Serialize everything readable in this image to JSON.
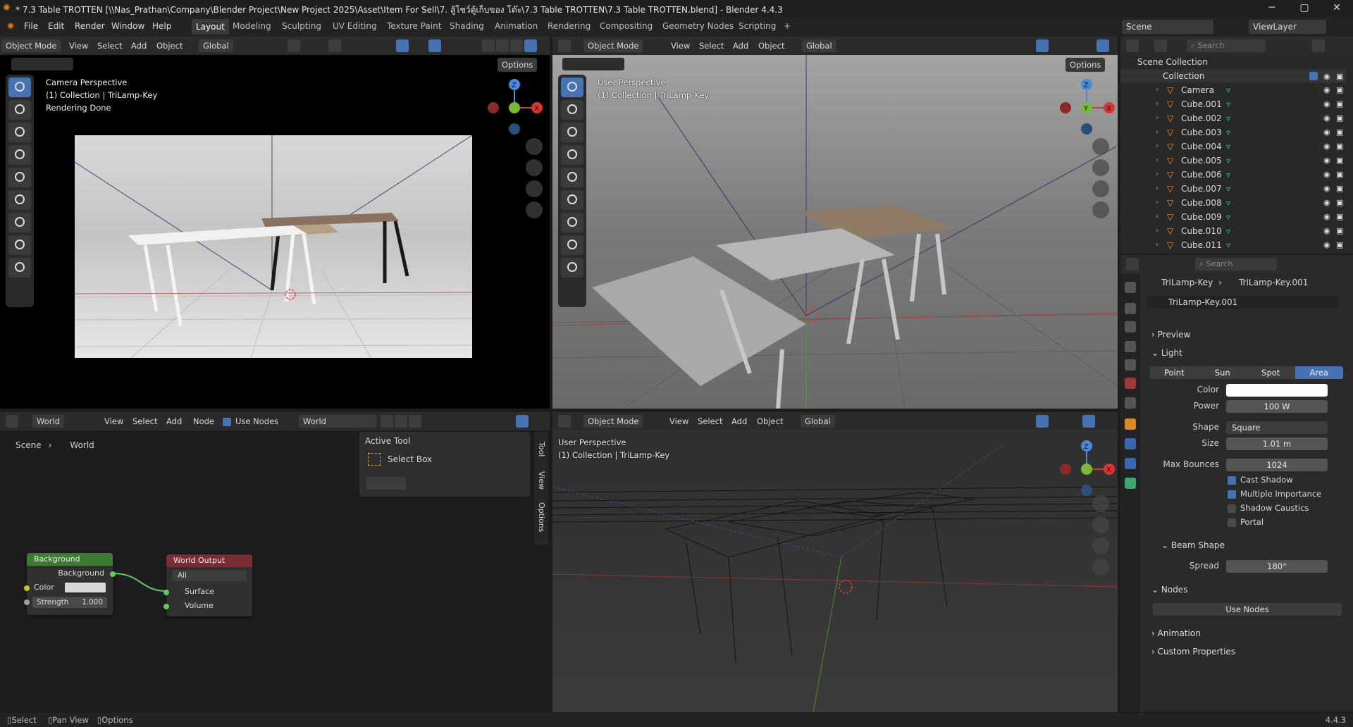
{
  "window": {
    "title": "* 7.3 Table TROTTEN [\\\\Nas_Prathan\\Company\\Blender Project\\New Project 2025\\Asset\\Item For Sell\\7. สู้โซว์ตู้เก็บของ โต๊ะ\\7.3 Table TROTTEN\\7.3 Table TROTTEN.blend] - Blender 4.4.3",
    "minimize": "─",
    "maximize": "▢",
    "close": "✕"
  },
  "menu": [
    "File",
    "Edit",
    "Render",
    "Window",
    "Help"
  ],
  "workspaces": [
    "Layout",
    "Modeling",
    "Sculpting",
    "UV Editing",
    "Texture Paint",
    "Shading",
    "Animation",
    "Rendering",
    "Compositing",
    "Geometry Nodes",
    "Scripting",
    "+"
  ],
  "scene": {
    "label": "Scene",
    "viewlayer": "ViewLayer"
  },
  "viewport_header": {
    "mode": "Object Mode",
    "items": [
      "View",
      "Select",
      "Add",
      "Object"
    ],
    "orientation": "Global",
    "options": "Options"
  },
  "camera_view": {
    "line1": "Camera Perspective",
    "line2": "(1) Collection | TriLamp-Key",
    "line3": "Rendering Done"
  },
  "user_view_top": {
    "line1": "User Perspective",
    "line2": "(1) Collection | TriLamp-Key"
  },
  "user_view_bottom": {
    "line1": "User Perspective",
    "line2": "(1) Collection | TriLamp-Key"
  },
  "gizmo": {
    "x": "X",
    "y": "Y",
    "z": "Z"
  },
  "node_editor": {
    "type": "World",
    "items": [
      "View",
      "Select",
      "Add",
      "Node"
    ],
    "use_nodes": "Use Nodes",
    "world_name": "World",
    "breadcrumb": [
      "Scene",
      "World"
    ],
    "side_tabs": [
      "Tool",
      "View",
      "Options"
    ],
    "active_tool": {
      "title": "Active Tool",
      "tool": "Select Box"
    },
    "background_node": {
      "title": "Background",
      "output": "Background",
      "color_label": "Color",
      "strength_label": "Strength",
      "strength_value": "1.000"
    },
    "output_node": {
      "title": "World Output",
      "target": "All",
      "inputs": [
        "Surface",
        "Volume"
      ]
    }
  },
  "outliner": {
    "search_placeholder": "Search",
    "root": "Scene Collection",
    "collection": "Collection",
    "items": [
      "Camera",
      "Cube.001",
      "Cube.002",
      "Cube.003",
      "Cube.004",
      "Cube.005",
      "Cube.006",
      "Cube.007",
      "Cube.008",
      "Cube.009",
      "Cube.010",
      "Cube.011"
    ]
  },
  "properties": {
    "search_placeholder": "Search",
    "breadcrumb_object": "TriLamp-Key",
    "breadcrumb_data": "TriLamp-Key.001",
    "datablock": "TriLamp-Key.001",
    "sections": {
      "preview": "Preview",
      "light": "Light",
      "nodes": "Nodes",
      "animation": "Animation",
      "custom": "Custom Properties"
    },
    "light_types": [
      "Point",
      "Sun",
      "Spot",
      "Area"
    ],
    "active_type": "Area",
    "color_label": "Color",
    "color_value": "#ffffff",
    "power_label": "Power",
    "power_value": "100 W",
    "shape_label": "Shape",
    "shape_value": "Square",
    "size_label": "Size",
    "size_value": "1.01 m",
    "bounces_label": "Max Bounces",
    "bounces_value": "1024",
    "checkboxes": [
      {
        "label": "Cast Shadow",
        "checked": true
      },
      {
        "label": "Multiple Importance",
        "checked": true
      },
      {
        "label": "Shadow Caustics",
        "checked": false
      },
      {
        "label": "Portal",
        "checked": false
      }
    ],
    "beam_shape": "Beam Shape",
    "spread_label": "Spread",
    "spread_value": "180°",
    "use_nodes_button": "Use Nodes"
  },
  "statusbar": {
    "select": "Select",
    "pan": "Pan View",
    "options": "Options",
    "version": "4.4.3"
  },
  "colors": {
    "accent": "#4772b3",
    "bg": "#1d1d1d",
    "header": "#2b2b2b",
    "node_bg_header": "#3d7b34",
    "node_out_header": "#7a2c35"
  }
}
